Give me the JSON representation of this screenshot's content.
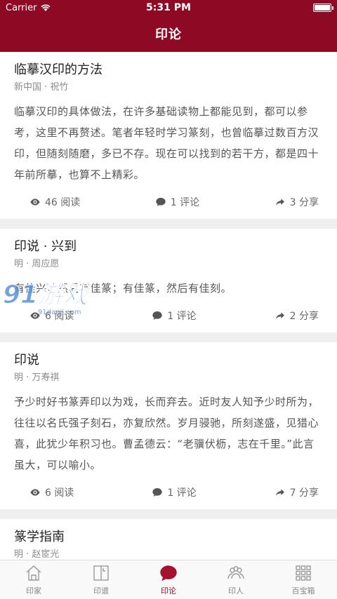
{
  "status": {
    "carrier": "Carrier",
    "time": "5:31 PM"
  },
  "nav": {
    "title": "印论"
  },
  "articles": [
    {
      "title": "临摹汉印的方法",
      "meta": "新中国 · 祝竹",
      "body": "临摹汉印的具体做法，在许多基础读物上都能见到，都可以参考，这里不再赘述。笔者年轻时学习篆刻，也曾临摹过数百方汉印，但随刻随磨，多已不存。现在可以找到的若干方，都是四十年前所摹，也算不上精彩。",
      "reads": "46 阅读",
      "comments": "1 评论",
      "shares": "3 分享"
    },
    {
      "title": "印说 · 兴到",
      "meta": "明 · 周应愿",
      "body": "有佳兴，然后有佳篆；有佳篆，然后有佳刻。",
      "reads": "6 阅读",
      "comments": "1 评论",
      "shares": "2 分享"
    },
    {
      "title": "印说",
      "meta": "明 · 万寿祺",
      "body": "予少时好书篆弄印以为戏，长而弃去。近时友人知予少时所为，往往以名氏强子刻石，亦复欣然。岁月骎驰，所刻遂盛，见猎心喜，此犹少年积习也。曹孟德云：“老骥伏枥，志在千里。”此言虽大，可以喻小。",
      "reads": "6 阅读",
      "comments": "1 评论",
      "shares": "7 分享"
    },
    {
      "title": "篆学指南",
      "meta": "明 · 赵宧光",
      "body": "",
      "reads": "",
      "comments": "",
      "shares": ""
    }
  ],
  "tabs": [
    {
      "label": "印家",
      "icon": "home-icon",
      "active": false
    },
    {
      "label": "印谱",
      "icon": "book-icon",
      "active": false
    },
    {
      "label": "印论",
      "icon": "chat-bubble-icon",
      "active": true
    },
    {
      "label": "印人",
      "icon": "people-icon",
      "active": false
    },
    {
      "label": "百宝箱",
      "icon": "grid-icon",
      "active": false
    }
  ],
  "watermark": {
    "text": "91游戏",
    "sub": "91danji.com"
  },
  "colors": {
    "brand": "#8e0a24",
    "active_tab": "#a4122e",
    "watermark": "#5b8fd8"
  }
}
